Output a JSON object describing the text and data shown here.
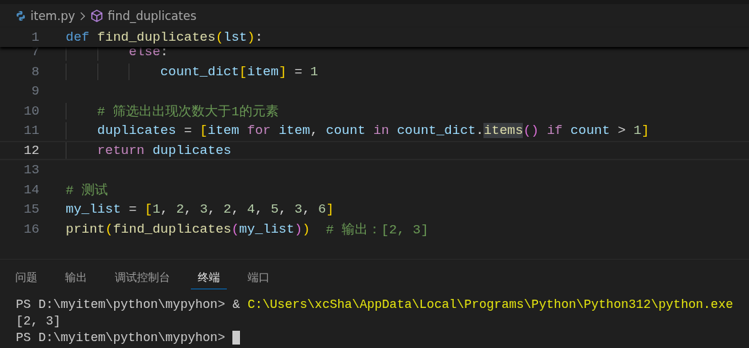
{
  "breadcrumb": {
    "file": "item.py",
    "symbol": "find_duplicates"
  },
  "sticky_line": {
    "num": "1",
    "tokens": [
      {
        "kind": "keyword",
        "text": "def "
      },
      {
        "kind": "function",
        "text": "find_duplicates"
      },
      {
        "kind": "bracket1",
        "text": "("
      },
      {
        "kind": "variable",
        "text": "lst"
      },
      {
        "kind": "bracket1",
        "text": ")"
      },
      {
        "kind": "operator",
        "text": ":"
      }
    ]
  },
  "lines": [
    {
      "num": "7",
      "current": false,
      "tokens": [
        {
          "kind": "control",
          "text": "        else"
        },
        {
          "kind": "operator",
          "text": ":"
        }
      ]
    },
    {
      "num": "8",
      "current": false,
      "tokens": [
        {
          "kind": "variable",
          "text": "            count_dict"
        },
        {
          "kind": "bracket1",
          "text": "["
        },
        {
          "kind": "variable",
          "text": "item"
        },
        {
          "kind": "bracket1",
          "text": "]"
        },
        {
          "kind": "operator",
          "text": " = "
        },
        {
          "kind": "number",
          "text": "1"
        }
      ]
    },
    {
      "num": "9",
      "current": false
    },
    {
      "num": "10",
      "current": false,
      "tokens": [
        {
          "kind": "comment",
          "text": "    # 筛选出出现次数大于1的元素"
        }
      ]
    },
    {
      "num": "11",
      "current": false,
      "tokens": [
        {
          "kind": "variable",
          "text": "    duplicates"
        },
        {
          "kind": "operator",
          "text": " = "
        },
        {
          "kind": "bracket1",
          "text": "["
        },
        {
          "kind": "variable",
          "text": "item "
        },
        {
          "kind": "control",
          "text": "for "
        },
        {
          "kind": "variable",
          "text": "item"
        },
        {
          "kind": "operator",
          "text": ", "
        },
        {
          "kind": "variable",
          "text": "count "
        },
        {
          "kind": "control",
          "text": "in "
        },
        {
          "kind": "variable",
          "text": "count_dict"
        },
        {
          "kind": "operator",
          "text": "."
        },
        {
          "kind": "function_highlight",
          "text": "items"
        },
        {
          "kind": "bracket2",
          "text": "() "
        },
        {
          "kind": "control",
          "text": "if "
        },
        {
          "kind": "variable",
          "text": "count"
        },
        {
          "kind": "operator",
          "text": " > "
        },
        {
          "kind": "number",
          "text": "1"
        },
        {
          "kind": "bracket1",
          "text": "]"
        }
      ]
    },
    {
      "num": "12",
      "current": true,
      "tokens": [
        {
          "kind": "control",
          "text": "    return "
        },
        {
          "kind": "variable",
          "text": "duplicates"
        }
      ]
    },
    {
      "num": "13",
      "current": false
    },
    {
      "num": "14",
      "current": false,
      "tokens": [
        {
          "kind": "comment",
          "text": "# 测试"
        }
      ]
    },
    {
      "num": "15",
      "current": false,
      "tokens": [
        {
          "kind": "variable",
          "text": "my_list"
        },
        {
          "kind": "operator",
          "text": " = "
        },
        {
          "kind": "bracket1",
          "text": "["
        },
        {
          "kind": "number",
          "text": "1"
        },
        {
          "kind": "operator",
          "text": ", "
        },
        {
          "kind": "number",
          "text": "2"
        },
        {
          "kind": "operator",
          "text": ", "
        },
        {
          "kind": "number",
          "text": "3"
        },
        {
          "kind": "operator",
          "text": ", "
        },
        {
          "kind": "number",
          "text": "2"
        },
        {
          "kind": "operator",
          "text": ", "
        },
        {
          "kind": "number",
          "text": "4"
        },
        {
          "kind": "operator",
          "text": ", "
        },
        {
          "kind": "number",
          "text": "5"
        },
        {
          "kind": "operator",
          "text": ", "
        },
        {
          "kind": "number",
          "text": "3"
        },
        {
          "kind": "operator",
          "text": ", "
        },
        {
          "kind": "number",
          "text": "6"
        },
        {
          "kind": "bracket1",
          "text": "]"
        }
      ]
    },
    {
      "num": "16",
      "current": false,
      "tokens": [
        {
          "kind": "function",
          "text": "print"
        },
        {
          "kind": "bracket1",
          "text": "("
        },
        {
          "kind": "function",
          "text": "find_duplicates"
        },
        {
          "kind": "bracket2",
          "text": "("
        },
        {
          "kind": "variable",
          "text": "my_list"
        },
        {
          "kind": "bracket2",
          "text": ")"
        },
        {
          "kind": "bracket1",
          "text": ")  "
        },
        {
          "kind": "comment",
          "text": "# 输出：[2, 3]"
        }
      ]
    }
  ],
  "panel_tabs": [
    {
      "label": "问题",
      "selected": false
    },
    {
      "label": "输出",
      "selected": false
    },
    {
      "label": "调试控制台",
      "selected": false
    },
    {
      "label": "终端",
      "selected": true
    },
    {
      "label": "端口",
      "selected": false
    }
  ],
  "terminal": [
    {
      "cursor": false,
      "segments": [
        {
          "kind": "prompt",
          "text": "PS D:\\myitem\\python\\mypyhon> "
        },
        {
          "kind": "output",
          "text": "& "
        },
        {
          "kind": "path",
          "text": "C:\\Users\\xcSha\\AppData\\Local\\Programs\\Python\\Python312\\python.exe"
        }
      ]
    },
    {
      "cursor": false,
      "segments": [
        {
          "kind": "output",
          "text": "[2, 3]"
        }
      ]
    },
    {
      "cursor": true,
      "segments": [
        {
          "kind": "prompt",
          "text": "PS D:\\myitem\\python\\mypyhon> "
        }
      ]
    }
  ]
}
